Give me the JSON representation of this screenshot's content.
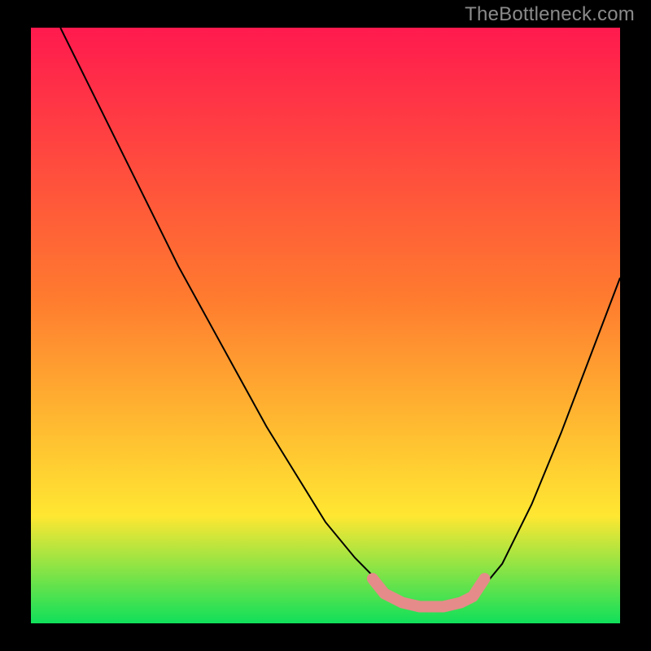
{
  "watermark": "TheBottleneck.com",
  "chart_data": {
    "type": "line",
    "title": "",
    "xlabel": "",
    "ylabel": "",
    "xlim": [
      0,
      100
    ],
    "ylim": [
      0,
      100
    ],
    "grid": false,
    "legend": false,
    "background_gradient": {
      "start": "#ff1a4e",
      "mid1": "#ff7a2f",
      "mid2": "#ffe732",
      "end": "#10e05a",
      "stops": [
        0,
        0.45,
        0.82,
        1.0
      ]
    },
    "series": [
      {
        "name": "bottleneck-curve",
        "color": "#000000",
        "stroke_width": 2,
        "x": [
          5,
          10,
          15,
          20,
          25,
          30,
          35,
          40,
          45,
          50,
          55,
          60,
          63,
          66,
          70,
          73,
          75,
          80,
          85,
          90,
          95,
          100
        ],
        "y": [
          100,
          90,
          80,
          70,
          60,
          51,
          42,
          33,
          25,
          17,
          11,
          6,
          4,
          3,
          3,
          3,
          4,
          10,
          20,
          32,
          45,
          58
        ]
      },
      {
        "name": "optimal-zone-marker",
        "color": "#e58b89",
        "stroke_width": 7,
        "stroke_linecap": "round",
        "x": [
          58,
          60,
          63,
          66,
          70,
          73,
          75,
          77
        ],
        "y": [
          7.5,
          5,
          3.5,
          2.8,
          2.8,
          3.5,
          4.5,
          7.5
        ]
      }
    ]
  }
}
